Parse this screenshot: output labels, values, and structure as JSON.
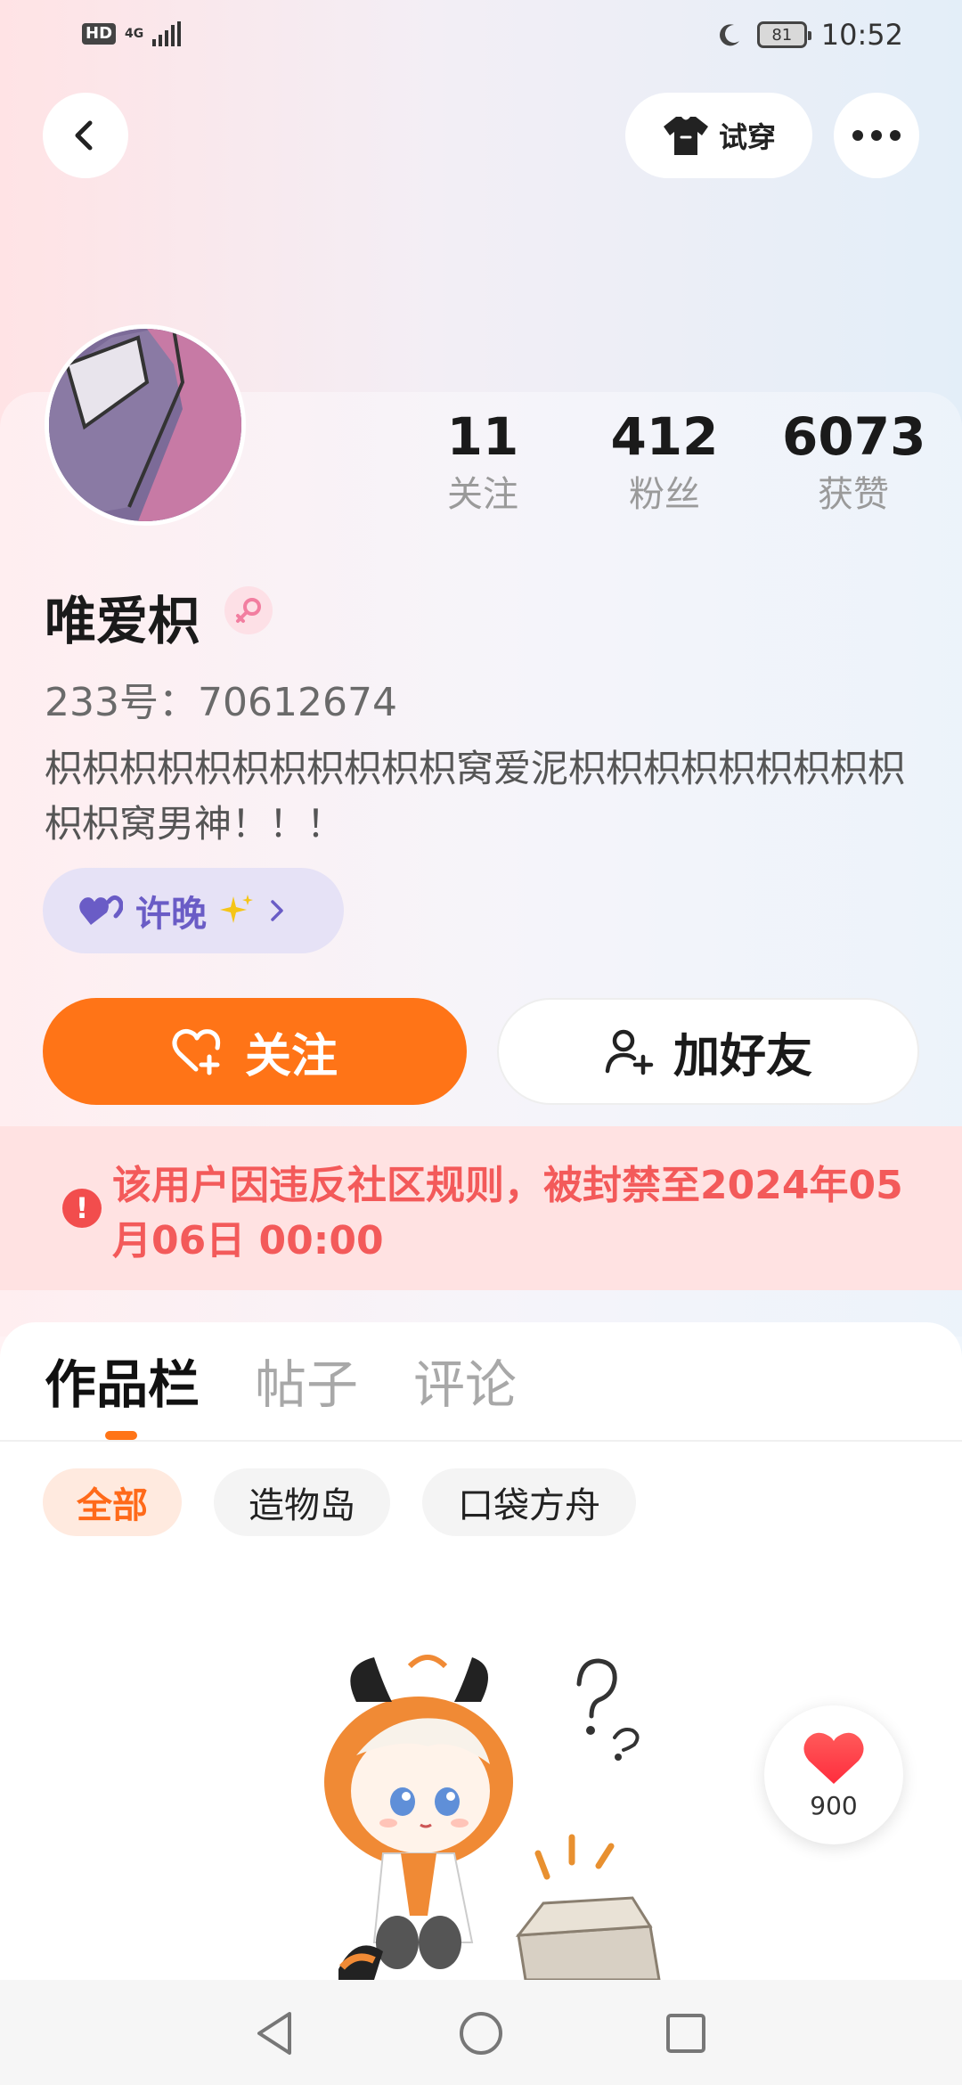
{
  "status_bar": {
    "hd": "HD",
    "network": "4G",
    "battery": "81",
    "time": "10:52"
  },
  "top_bar": {
    "try_on_label": "试穿"
  },
  "profile": {
    "username": "唯爱枳",
    "uid_text": "233号：70612674",
    "bio": "枳枳枳枳枳枳枳枳枳枳枳窝爱泥枳枳枳枳枳枳枳枳枳枳枳窝男神！！！",
    "tag_label": "许晚",
    "stats": [
      {
        "value": "11",
        "label": "关注"
      },
      {
        "value": "412",
        "label": "粉丝"
      },
      {
        "value": "6073",
        "label": "获赞"
      }
    ]
  },
  "actions": {
    "follow_label": "关注",
    "add_friend_label": "加好友"
  },
  "ban_notice": {
    "icon": "!",
    "text": "该用户因违反社区规则，被封禁至2024年05月06日 00:00"
  },
  "tabs": [
    {
      "label": "作品栏",
      "active": true
    },
    {
      "label": "帖子",
      "active": false
    },
    {
      "label": "评论",
      "active": false
    }
  ],
  "filter_chips": [
    {
      "label": "全部",
      "active": true
    },
    {
      "label": "造物岛",
      "active": false
    },
    {
      "label": "口袋方舟",
      "active": false
    }
  ],
  "floating_like": {
    "count": "900"
  },
  "colors": {
    "accent": "#ff7417",
    "ban_text": "#f35a5a",
    "tag_purple": "#6a5cc6"
  }
}
